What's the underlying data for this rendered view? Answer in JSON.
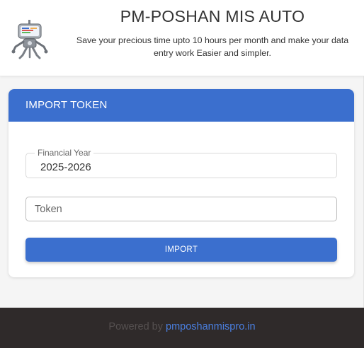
{
  "header": {
    "title": "PM-POSHAN MIS AUTO",
    "tagline": "Save your precious time upto 10 hours per month and make your data entry work Easier and simpler.",
    "logo_icon": "robot-icon"
  },
  "card": {
    "title": "IMPORT TOKEN",
    "financial_year": {
      "label": "Financial Year",
      "value": "2025-2026"
    },
    "token": {
      "placeholder": "Token",
      "value": ""
    },
    "import_label": "IMPORT"
  },
  "footer": {
    "powered_by": "Powered by",
    "link_text": "pmposhanmispro.in"
  },
  "colors": {
    "accent": "#3b6fce",
    "footer_bg": "#2f2a2a",
    "link": "#4a7fe0"
  }
}
